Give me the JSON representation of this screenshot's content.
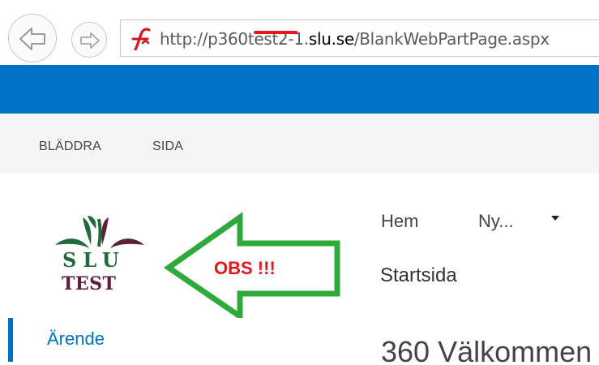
{
  "browser": {
    "url_prefix": "http://p360",
    "url_marked": "test2",
    "url_mid": "-1.",
    "url_host": "slu.se",
    "url_path": "/BlankWebPartPage.aspx",
    "back_icon": "back-arrow-icon",
    "forward_icon": "forward-arrow-icon",
    "site_icon": "site-favicon-icon"
  },
  "ribbon": {
    "tabs": [
      {
        "label": "BLÄDDRA"
      },
      {
        "label": "SIDA"
      }
    ]
  },
  "logo": {
    "line1": "SLU",
    "line2": "TEST"
  },
  "annotation": {
    "text": "OBS !!!"
  },
  "top_nav": {
    "items": [
      {
        "label": "Hem"
      },
      {
        "label": "Ny..."
      }
    ]
  },
  "breadcrumb": {
    "site": "Startsida"
  },
  "quick_launch": {
    "items": [
      {
        "label": "Ärende"
      }
    ]
  },
  "page": {
    "title": "360 Välkommen"
  },
  "colors": {
    "suite_bar": "#0072c6",
    "accent": "#0072c6",
    "annotation_arrow": "#2eaa3a",
    "annotation_text": "#e6141b",
    "url_mark": "#e8141e",
    "logo_green": "#1e6b3c",
    "logo_maroon": "#5e1f3a"
  }
}
